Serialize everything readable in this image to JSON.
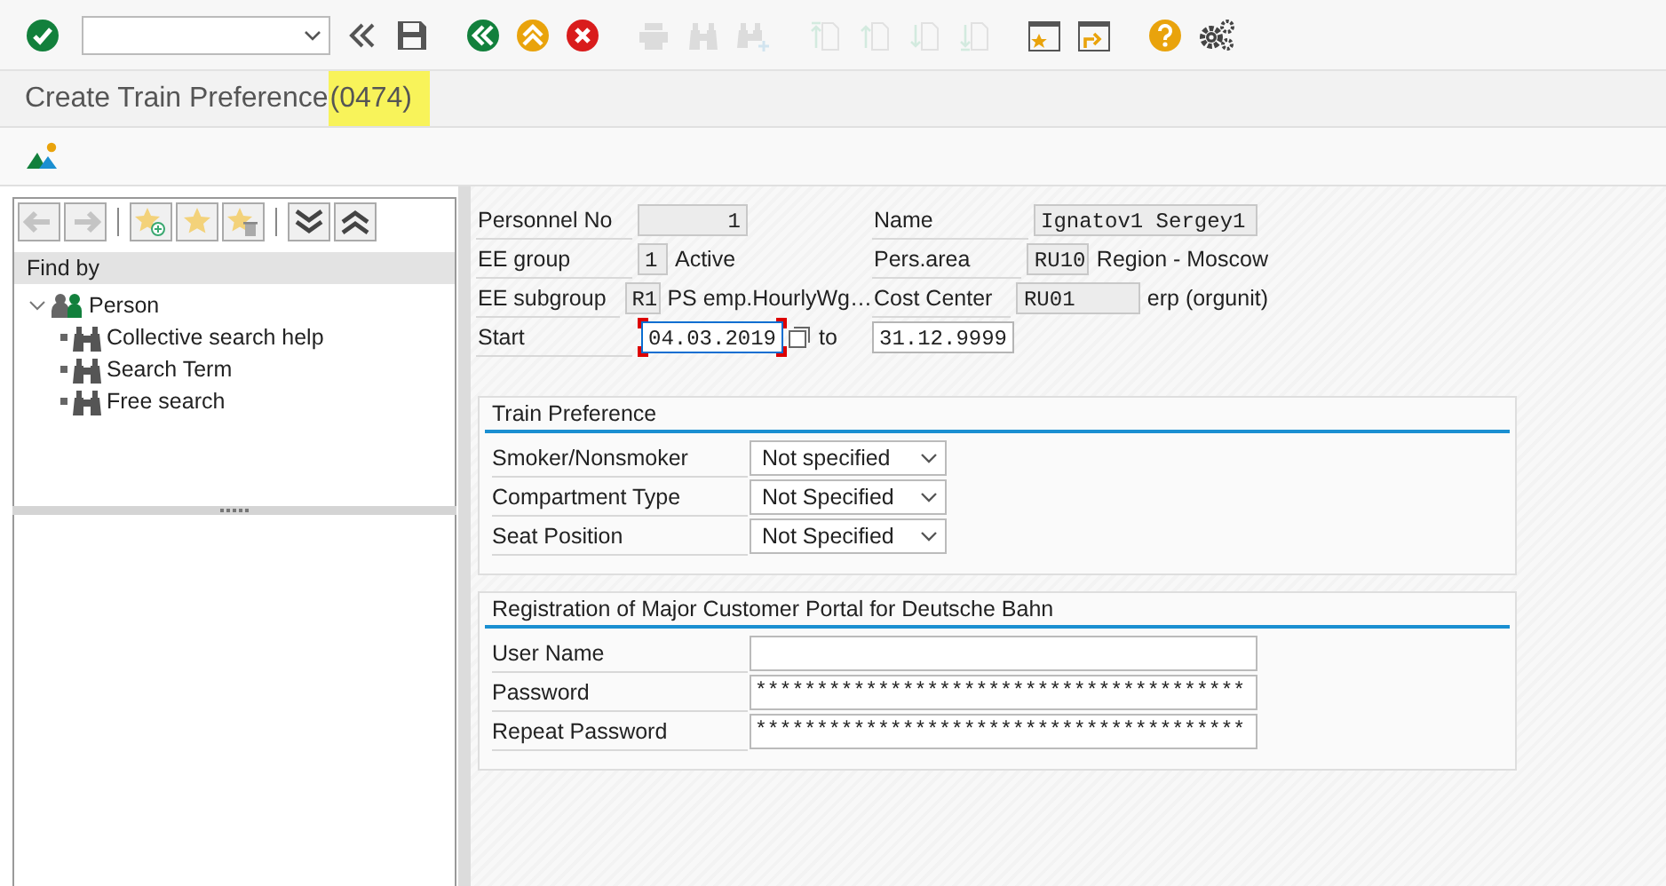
{
  "toolbar": {
    "buttons": [
      {
        "kind": "enter",
        "disabled": false
      },
      {
        "kind": "command_field"
      },
      {
        "kind": "collapse",
        "disabled": false
      },
      {
        "kind": "save",
        "disabled": false
      },
      {
        "kind": "back",
        "disabled": false
      },
      {
        "kind": "exit",
        "disabled": false
      },
      {
        "kind": "cancel",
        "disabled": false
      },
      {
        "kind": "print",
        "disabled": true
      },
      {
        "kind": "find",
        "disabled": true
      },
      {
        "kind": "find_next",
        "disabled": true
      },
      {
        "kind": "first_page",
        "disabled": true
      },
      {
        "kind": "previous_page",
        "disabled": true
      },
      {
        "kind": "next_page",
        "disabled": true
      },
      {
        "kind": "last_page",
        "disabled": true
      },
      {
        "kind": "new_session",
        "disabled": false
      },
      {
        "kind": "shortcut",
        "disabled": false
      },
      {
        "kind": "help",
        "disabled": false
      },
      {
        "kind": "settings",
        "disabled": false
      }
    ]
  },
  "title": {
    "text": "Create Train Preference",
    "code": "(0474)",
    "code_highlighted": true
  },
  "application_toolbar": {
    "buttons": [
      {
        "kind": "image",
        "disabled": false
      }
    ]
  },
  "navigation": {
    "toolbar": [
      {
        "kind": "back",
        "disabled": true
      },
      {
        "kind": "forward",
        "disabled": true
      },
      {
        "kind": "separator"
      },
      {
        "kind": "add_favorite",
        "disabled": false
      },
      {
        "kind": "favorite",
        "disabled": false
      },
      {
        "kind": "delete_favorite",
        "disabled": false
      },
      {
        "kind": "separator"
      },
      {
        "kind": "expand_all",
        "disabled": false
      },
      {
        "kind": "collapse_all",
        "disabled": false
      }
    ],
    "header": "Find by",
    "tree": [
      {
        "label": "Person",
        "kind": "person",
        "expanded": true,
        "children": [
          {
            "label": "Collective search help",
            "kind": "search"
          },
          {
            "label": "Search Term",
            "kind": "search"
          },
          {
            "label": "Free search",
            "kind": "search"
          }
        ]
      }
    ]
  },
  "header": {
    "rows": [
      [
        {
          "label": "Personnel No",
          "value": "1",
          "editable": false
        },
        {
          "label": "Name",
          "value": "Ignatov1 Sergey1",
          "editable": false
        }
      ],
      [
        {
          "label": "EE group",
          "value": "1",
          "text": "Active",
          "editable": false
        },
        {
          "label": "Pers.area",
          "value": "RU10",
          "text": "Region - Moscow",
          "editable": false
        }
      ],
      [
        {
          "label": "EE subgroup",
          "value": "R1",
          "text": "PS emp.HourlyWg…",
          "editable": false
        },
        {
          "label": "Cost Center",
          "value": "RU01",
          "text": "erp (orgunit)",
          "editable": false
        }
      ],
      [
        {
          "label": "Start",
          "value": "04.03.2019",
          "editable": true,
          "focused": true,
          "to_label": "to",
          "to_value": "31.12.9999"
        }
      ]
    ]
  },
  "groups": [
    {
      "title": "Train Preference",
      "fields": [
        {
          "kind": "dropdown",
          "label": "Smoker/Nonsmoker",
          "value": "Not specified"
        },
        {
          "kind": "dropdown",
          "label": "Compartment Type",
          "value": "Not Specified"
        },
        {
          "kind": "dropdown",
          "label": "Seat Position",
          "value": "Not Specified"
        }
      ]
    },
    {
      "title": "Registration of Major Customer Portal for Deutsche Bahn",
      "fields": [
        {
          "kind": "input",
          "label": "User Name"
        },
        {
          "kind": "password",
          "label": "Password",
          "value": "****************************************"
        },
        {
          "kind": "password",
          "label": "Repeat Password",
          "value": "****************************************"
        }
      ]
    }
  ]
}
